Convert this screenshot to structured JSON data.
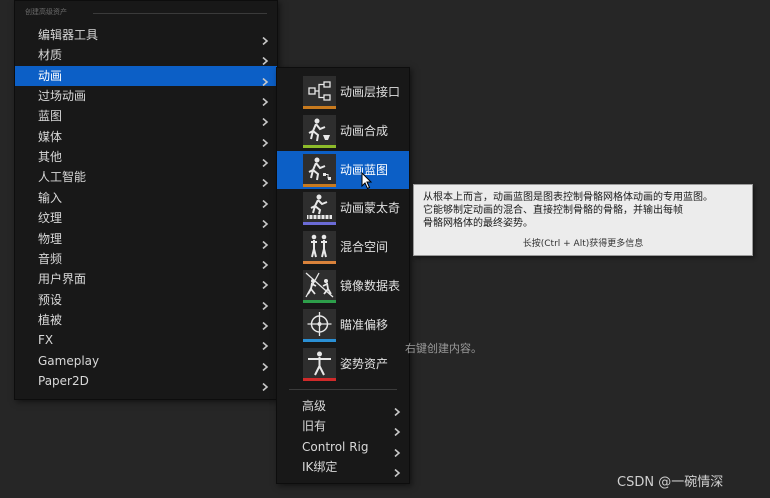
{
  "main_menu": {
    "header": "创建高级资产",
    "items": [
      {
        "label": "编辑器工具"
      },
      {
        "label": "材质"
      },
      {
        "label": "动画"
      },
      {
        "label": "过场动画"
      },
      {
        "label": "蓝图"
      },
      {
        "label": "媒体"
      },
      {
        "label": "其他"
      },
      {
        "label": "人工智能"
      },
      {
        "label": "输入"
      },
      {
        "label": "纹理"
      },
      {
        "label": "物理"
      },
      {
        "label": "音频"
      },
      {
        "label": "用户界面"
      },
      {
        "label": "预设"
      },
      {
        "label": "植被"
      },
      {
        "label": "FX"
      },
      {
        "label": "Gameplay"
      },
      {
        "label": "Paper2D"
      }
    ],
    "selected": "动画"
  },
  "animation_submenu": {
    "assets": [
      {
        "label": "动画层接口",
        "icon": "layer-interface-icon",
        "accent": "#c87a1e"
      },
      {
        "label": "动画合成",
        "icon": "anim-composite-icon",
        "accent": "#8dbb2a"
      },
      {
        "label": "动画蓝图",
        "icon": "anim-blueprint-icon",
        "accent": "#c87a1e"
      },
      {
        "label": "动画蒙太奇",
        "icon": "anim-montage-icon",
        "accent": "#6b6bd6"
      },
      {
        "label": "混合空间",
        "icon": "blend-space-icon",
        "accent": "#d9823b"
      },
      {
        "label": "镜像数据表",
        "icon": "mirror-table-icon",
        "accent": "#2d9e4a"
      },
      {
        "label": "瞄准偏移",
        "icon": "aim-offset-icon",
        "accent": "#2a8fd4"
      },
      {
        "label": "姿势资产",
        "icon": "pose-asset-icon",
        "accent": "#d02a2a"
      }
    ],
    "hovered": "动画蓝图",
    "submenus": [
      {
        "label": "高级"
      },
      {
        "label": "旧有"
      },
      {
        "label": "Control Rig"
      },
      {
        "label": "IK绑定"
      }
    ]
  },
  "tooltip": {
    "lines": [
      "从根本上而言，动画蓝图是图表控制骨骼网格体动画的专用蓝图。",
      "它能够制定动画的混合、直接控制骨骼的骨骼，并输出每帧",
      "骨骼网格体的最终姿势。"
    ],
    "hint": "长按(Ctrl + Alt)获得更多信息"
  },
  "background_hint": "右键创建内容。",
  "watermark": "CSDN @一碗情深",
  "colors": {
    "selection": "#0c5fc6",
    "menu_bg": "#181818",
    "page_bg": "#262626"
  }
}
